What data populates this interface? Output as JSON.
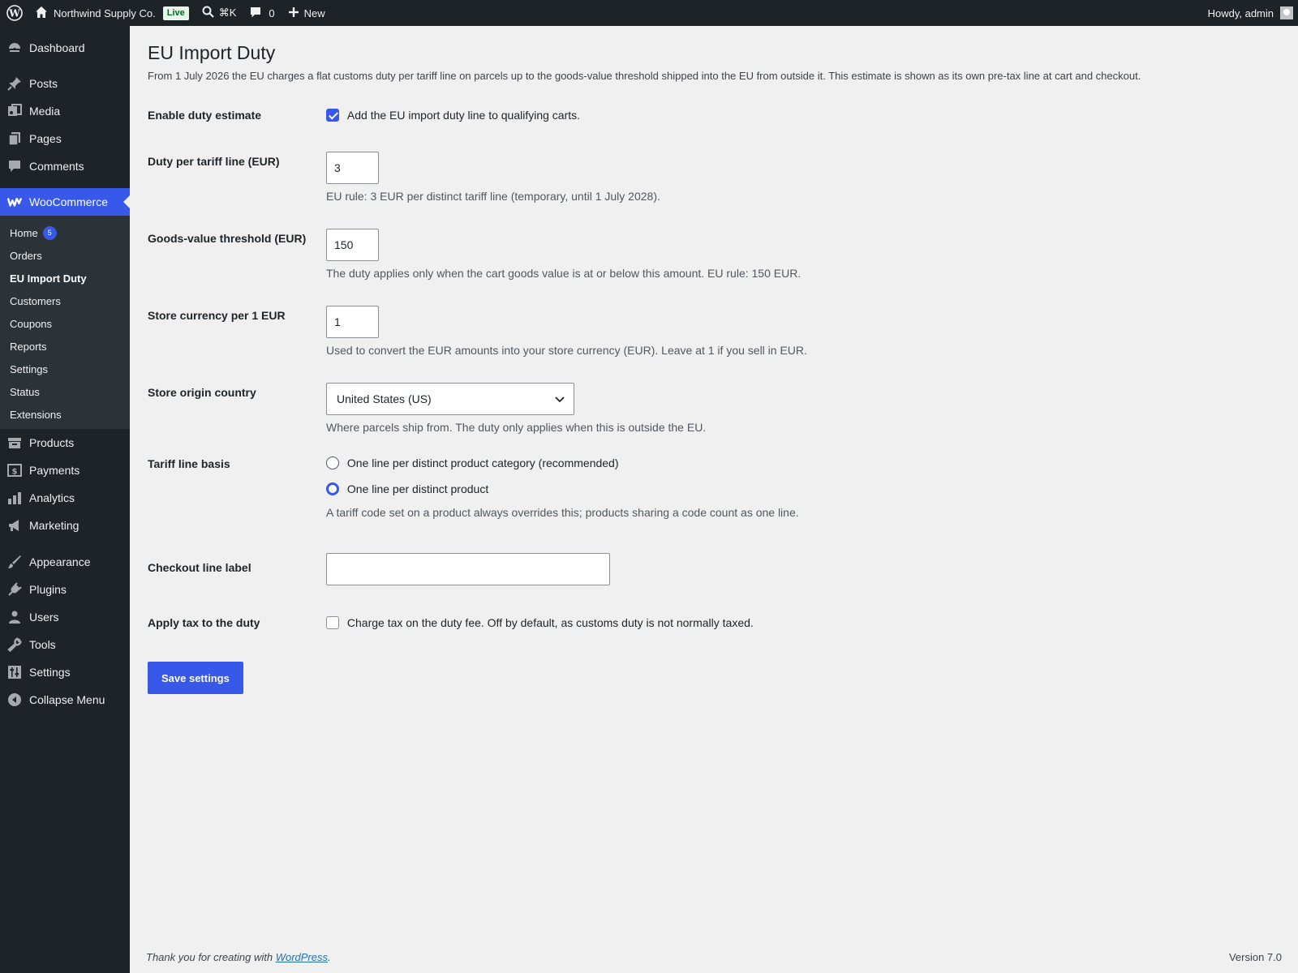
{
  "adminbar": {
    "site_name": "Northwind Supply Co.",
    "live_badge": "Live",
    "search_shortcut": "⌘K",
    "comments_count": "0",
    "new_label": "New",
    "howdy": "Howdy, admin"
  },
  "sidebar": {
    "items_top": [
      {
        "label": "Dashboard",
        "icon": "dashboard-icon"
      }
    ],
    "items_content": [
      {
        "label": "Posts",
        "icon": "pin-icon"
      },
      {
        "label": "Media",
        "icon": "media-icon"
      },
      {
        "label": "Pages",
        "icon": "pages-icon"
      },
      {
        "label": "Comments",
        "icon": "comment-icon"
      }
    ],
    "woocommerce": {
      "label": "WooCommerce",
      "icon": "woocommerce-icon"
    },
    "submenu": [
      {
        "label": "Home",
        "badge": "5"
      },
      {
        "label": "Orders"
      },
      {
        "label": "EU Import Duty"
      },
      {
        "label": "Customers"
      },
      {
        "label": "Coupons"
      },
      {
        "label": "Reports"
      },
      {
        "label": "Settings"
      },
      {
        "label": "Status"
      },
      {
        "label": "Extensions"
      }
    ],
    "items_commerce": [
      {
        "label": "Products",
        "icon": "products-icon"
      },
      {
        "label": "Payments",
        "icon": "payments-icon"
      },
      {
        "label": "Analytics",
        "icon": "analytics-icon"
      },
      {
        "label": "Marketing",
        "icon": "megaphone-icon"
      }
    ],
    "items_admin": [
      {
        "label": "Appearance",
        "icon": "brush-icon"
      },
      {
        "label": "Plugins",
        "icon": "plug-icon"
      },
      {
        "label": "Users",
        "icon": "user-icon"
      },
      {
        "label": "Tools",
        "icon": "wrench-icon"
      },
      {
        "label": "Settings",
        "icon": "settings-sliders-icon"
      },
      {
        "label": "Collapse Menu",
        "icon": "collapse-icon"
      }
    ]
  },
  "page": {
    "title": "EU Import Duty",
    "description": "From 1 July 2026 the EU charges a flat customs duty per tariff line on parcels up to the goods-value threshold shipped into the EU from outside it. This estimate is shown as its own pre-tax line at cart and checkout."
  },
  "form": {
    "enable": {
      "label": "Enable duty estimate",
      "checkbox_label": "Add the EU import duty line to qualifying carts.",
      "checked": true
    },
    "duty_per_line": {
      "label": "Duty per tariff line (EUR)",
      "value": "3",
      "description": "EU rule: 3 EUR per distinct tariff line (temporary, until 1 July 2028)."
    },
    "threshold": {
      "label": "Goods-value threshold (EUR)",
      "value": "150",
      "description": "The duty applies only when the cart goods value is at or below this amount. EU rule: 150 EUR."
    },
    "currency_rate": {
      "label": "Store currency per 1 EUR",
      "value": "1",
      "description": "Used to convert the EUR amounts into your store currency (EUR). Leave at 1 if you sell in EUR."
    },
    "origin": {
      "label": "Store origin country",
      "selected": "United States (US)",
      "description": "Where parcels ship from. The duty only applies when this is outside the EU."
    },
    "tariff_basis": {
      "label": "Tariff line basis",
      "options": [
        {
          "label": "One line per distinct product category (recommended)",
          "checked": false
        },
        {
          "label": "One line per distinct product",
          "checked": true
        }
      ],
      "description": "A tariff code set on a product always overrides this; products sharing a code count as one line."
    },
    "checkout_label": {
      "label": "Checkout line label",
      "value": ""
    },
    "apply_tax": {
      "label": "Apply tax to the duty",
      "checkbox_label": "Charge tax on the duty fee. Off by default, as customs duty is not normally taxed.",
      "checked": false
    },
    "save_label": "Save settings"
  },
  "footer": {
    "thanks_prefix": "Thank you for creating with ",
    "thanks_link": "WordPress",
    "thanks_suffix": ".",
    "version": "Version 7.0"
  },
  "colors": {
    "accent": "#3858e9",
    "sidebar_bg": "#1d2327",
    "submenu_bg": "#2c3338",
    "page_bg": "#f0f0f1"
  }
}
